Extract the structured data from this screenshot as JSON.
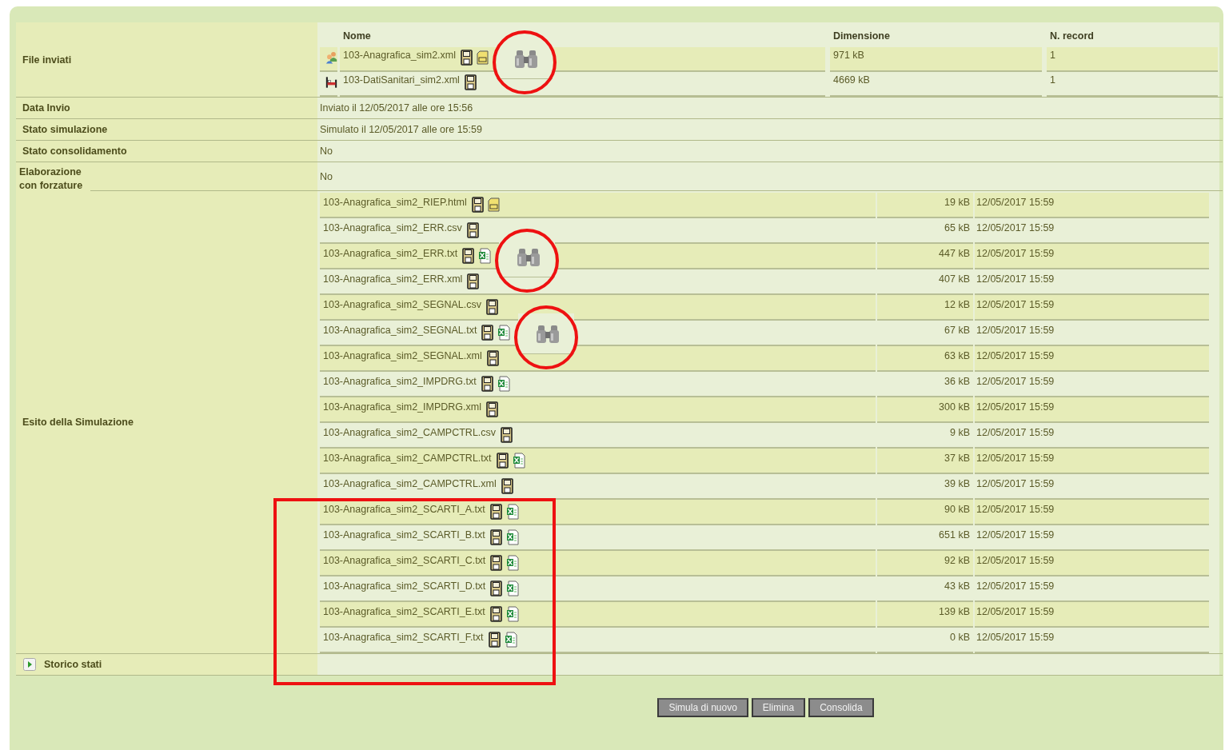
{
  "sent_files": {
    "label": "File inviati",
    "columns": [
      "Nome",
      "Dimensione",
      "N. record"
    ],
    "rows": [
      {
        "kind": "people",
        "name": "103-Anagrafica_sim2.xml",
        "actions": [
          {
            "kind": "save"
          },
          {
            "kind": "zip"
          }
        ],
        "preview": true,
        "size": "971 kB",
        "records": "1"
      },
      {
        "kind": "bed",
        "name": "103-DatiSanitari_sim2.xml",
        "actions": [
          {
            "kind": "save"
          }
        ],
        "preview": false,
        "size": "4669 kB",
        "records": "1"
      }
    ]
  },
  "fields": [
    {
      "label": "Data Invio",
      "value": "Inviato il 12/05/2017 alle ore 15:56"
    },
    {
      "label": "Stato simulazione",
      "value": "Simulato il 12/05/2017 alle ore 15:59"
    },
    {
      "label": "Stato consolidamento",
      "value": "No"
    },
    {
      "label": "Elaborazione con forzature",
      "value": "No"
    }
  ],
  "results": {
    "label": "Esito della Simulazione",
    "rows": [
      {
        "name": "103-Anagrafica_sim2_RIEP.html",
        "actions": [
          {
            "kind": "save"
          },
          {
            "kind": "zip"
          }
        ],
        "preview": false,
        "boxed": false,
        "size": "19 kB",
        "date": "12/05/2017 15:59"
      },
      {
        "name": "103-Anagrafica_sim2_ERR.csv",
        "actions": [
          {
            "kind": "save"
          }
        ],
        "preview": false,
        "boxed": false,
        "size": "65 kB",
        "date": "12/05/2017 15:59"
      },
      {
        "name": "103-Anagrafica_sim2_ERR.txt",
        "actions": [
          {
            "kind": "save"
          },
          {
            "kind": "excel"
          }
        ],
        "preview": true,
        "boxed": false,
        "size": "447 kB",
        "date": "12/05/2017 15:59"
      },
      {
        "name": "103-Anagrafica_sim2_ERR.xml",
        "actions": [
          {
            "kind": "save"
          }
        ],
        "preview": false,
        "boxed": false,
        "size": "407 kB",
        "date": "12/05/2017 15:59"
      },
      {
        "name": "103-Anagrafica_sim2_SEGNAL.csv",
        "actions": [
          {
            "kind": "save"
          }
        ],
        "preview": false,
        "boxed": false,
        "size": "12 kB",
        "date": "12/05/2017 15:59"
      },
      {
        "name": "103-Anagrafica_sim2_SEGNAL.txt",
        "actions": [
          {
            "kind": "save"
          },
          {
            "kind": "excel"
          }
        ],
        "preview": true,
        "boxed": false,
        "size": "67 kB",
        "date": "12/05/2017 15:59"
      },
      {
        "name": "103-Anagrafica_sim2_SEGNAL.xml",
        "actions": [
          {
            "kind": "save"
          }
        ],
        "preview": false,
        "boxed": false,
        "size": "63 kB",
        "date": "12/05/2017 15:59"
      },
      {
        "name": "103-Anagrafica_sim2_IMPDRG.txt",
        "actions": [
          {
            "kind": "save"
          },
          {
            "kind": "excel"
          }
        ],
        "preview": false,
        "boxed": false,
        "size": "36 kB",
        "date": "12/05/2017 15:59"
      },
      {
        "name": "103-Anagrafica_sim2_IMPDRG.xml",
        "actions": [
          {
            "kind": "save"
          }
        ],
        "preview": false,
        "boxed": false,
        "size": "300 kB",
        "date": "12/05/2017 15:59"
      },
      {
        "name": "103-Anagrafica_sim2_CAMPCTRL.csv",
        "actions": [
          {
            "kind": "save"
          }
        ],
        "preview": false,
        "boxed": false,
        "size": "9 kB",
        "date": "12/05/2017 15:59"
      },
      {
        "name": "103-Anagrafica_sim2_CAMPCTRL.txt",
        "actions": [
          {
            "kind": "save"
          },
          {
            "kind": "excel"
          }
        ],
        "preview": false,
        "boxed": false,
        "size": "37 kB",
        "date": "12/05/2017 15:59"
      },
      {
        "name": "103-Anagrafica_sim2_CAMPCTRL.xml",
        "actions": [
          {
            "kind": "save"
          }
        ],
        "preview": false,
        "boxed": false,
        "size": "39 kB",
        "date": "12/05/2017 15:59"
      },
      {
        "name": "103-Anagrafica_sim2_SCARTI_A.txt",
        "actions": [
          {
            "kind": "save"
          },
          {
            "kind": "excel"
          }
        ],
        "preview": false,
        "boxed": true,
        "size": "90 kB",
        "date": "12/05/2017 15:59"
      },
      {
        "name": "103-Anagrafica_sim2_SCARTI_B.txt",
        "actions": [
          {
            "kind": "save"
          },
          {
            "kind": "excel"
          }
        ],
        "preview": false,
        "boxed": true,
        "size": "651 kB",
        "date": "12/05/2017 15:59"
      },
      {
        "name": "103-Anagrafica_sim2_SCARTI_C.txt",
        "actions": [
          {
            "kind": "save"
          },
          {
            "kind": "excel"
          }
        ],
        "preview": false,
        "boxed": true,
        "size": "92 kB",
        "date": "12/05/2017 15:59"
      },
      {
        "name": "103-Anagrafica_sim2_SCARTI_D.txt",
        "actions": [
          {
            "kind": "save"
          },
          {
            "kind": "excel"
          }
        ],
        "preview": false,
        "boxed": true,
        "size": "43 kB",
        "date": "12/05/2017 15:59"
      },
      {
        "name": "103-Anagrafica_sim2_SCARTI_E.txt",
        "actions": [
          {
            "kind": "save"
          },
          {
            "kind": "excel"
          }
        ],
        "preview": false,
        "boxed": true,
        "size": "139 kB",
        "date": "12/05/2017 15:59"
      },
      {
        "name": "103-Anagrafica_sim2_SCARTI_F.txt",
        "actions": [
          {
            "kind": "save"
          },
          {
            "kind": "excel"
          }
        ],
        "preview": false,
        "boxed": true,
        "size": "0 kB",
        "date": "12/05/2017 15:59"
      }
    ]
  },
  "history": {
    "label": "Storico stati",
    "expanded": false
  },
  "buttons": [
    "Simula di nuovo",
    "Elimina",
    "Consolida"
  ]
}
